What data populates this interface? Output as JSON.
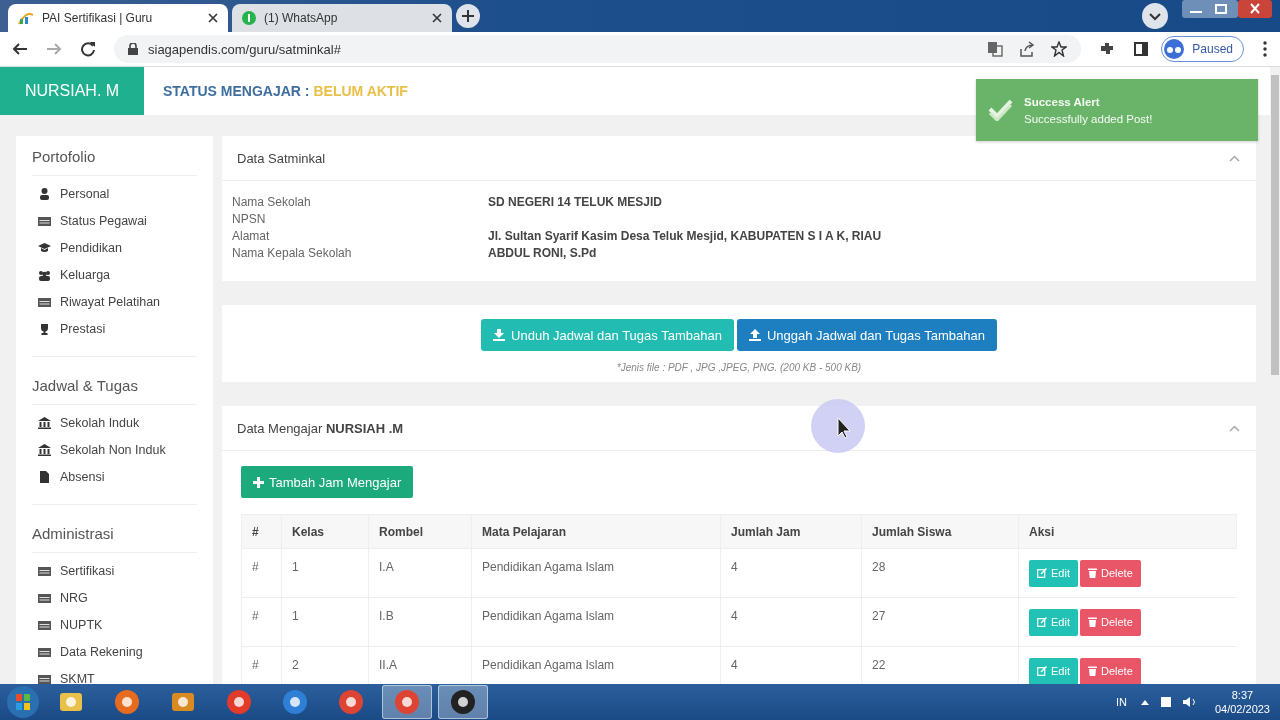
{
  "browser": {
    "tabs": [
      {
        "title": "PAI Sertifikasi | Guru",
        "selected": true
      },
      {
        "title": "(1) WhatsApp",
        "selected": false
      }
    ],
    "url": "siagapendis.com/guru/satminkal#",
    "profile": "Paused"
  },
  "header": {
    "brand": "NURSIAH. M",
    "status_label": "STATUS MENGAJAR :",
    "status_value": "BELUM AKTIF"
  },
  "toast": {
    "title": "Success Alert",
    "message": "Successfully added Post!"
  },
  "sidebar": {
    "sections": [
      {
        "title": "Portofolio",
        "items": [
          {
            "label": "Personal"
          },
          {
            "label": "Status Pegawai"
          },
          {
            "label": "Pendidikan"
          },
          {
            "label": "Keluarga"
          },
          {
            "label": "Riwayat Pelatihan"
          },
          {
            "label": "Prestasi"
          }
        ]
      },
      {
        "title": "Jadwal & Tugas",
        "items": [
          {
            "label": "Sekolah Induk"
          },
          {
            "label": "Sekolah Non Induk"
          },
          {
            "label": "Absensi"
          }
        ]
      },
      {
        "title": "Administrasi",
        "items": [
          {
            "label": "Sertifikasi"
          },
          {
            "label": "NRG"
          },
          {
            "label": "NUPTK"
          },
          {
            "label": "Data Rekening"
          },
          {
            "label": "SKMT"
          }
        ]
      }
    ]
  },
  "satminkal": {
    "title": "Data Satminkal",
    "fields": [
      {
        "label": "Nama Sekolah",
        "value": "SD NEGERI 14 TELUK MESJID"
      },
      {
        "label": "NPSN"
      },
      {
        "label": "Alamat",
        "value": "Jl. Sultan Syarif Kasim Desa Teluk Mesjid, KABUPATEN S I A K, RIAU"
      },
      {
        "label": "Nama Kepala Sekolah",
        "value": "ABDUL RONI, S.Pd"
      }
    ]
  },
  "files": {
    "buttons": [
      {
        "label": "Unduh Jadwal dan Tugas Tambahan",
        "kind": "download"
      },
      {
        "label": "Unggah Jadwal dan Tugas Tambahan",
        "kind": "upload"
      }
    ],
    "note": "*Jenis file : PDF , JPG ,JPEG, PNG. (200 KB - 500 KB)"
  },
  "teaching": {
    "title": "Data Mengajar **NURSIAH .M**",
    "add_button": "Tambah Jam Mengajar",
    "columns": [
      "#",
      "Kelas",
      "Rombel",
      "Mata Pelajaran",
      "Jumlah Jam",
      "Jumlah Siswa",
      "Aksi"
    ],
    "rows": [
      {
        "cells": [
          "#",
          "1",
          "I.A",
          "Pendidikan Agama Islam",
          "4",
          "28"
        ],
        "edit": "Edit",
        "delete": "Delete"
      },
      {
        "cells": [
          "#",
          "1",
          "I.B",
          "Pendidikan Agama Islam",
          "4",
          "27"
        ],
        "edit": "Edit",
        "delete": "Delete"
      },
      {
        "cells": [
          "#",
          "2",
          "II.A",
          "Pendidikan Agama Islam",
          "4",
          "22"
        ],
        "edit": "Edit",
        "delete": "Delete"
      }
    ]
  },
  "taskbar": {
    "apps": [
      {
        "selected": false
      },
      {
        "selected": false
      },
      {
        "selected": false
      },
      {
        "selected": false
      },
      {
        "selected": false
      },
      {
        "selected": false
      },
      {
        "selected": true
      },
      {
        "selected": true
      }
    ],
    "language": "IN",
    "time": "8:37",
    "date": "04/02/2023"
  }
}
